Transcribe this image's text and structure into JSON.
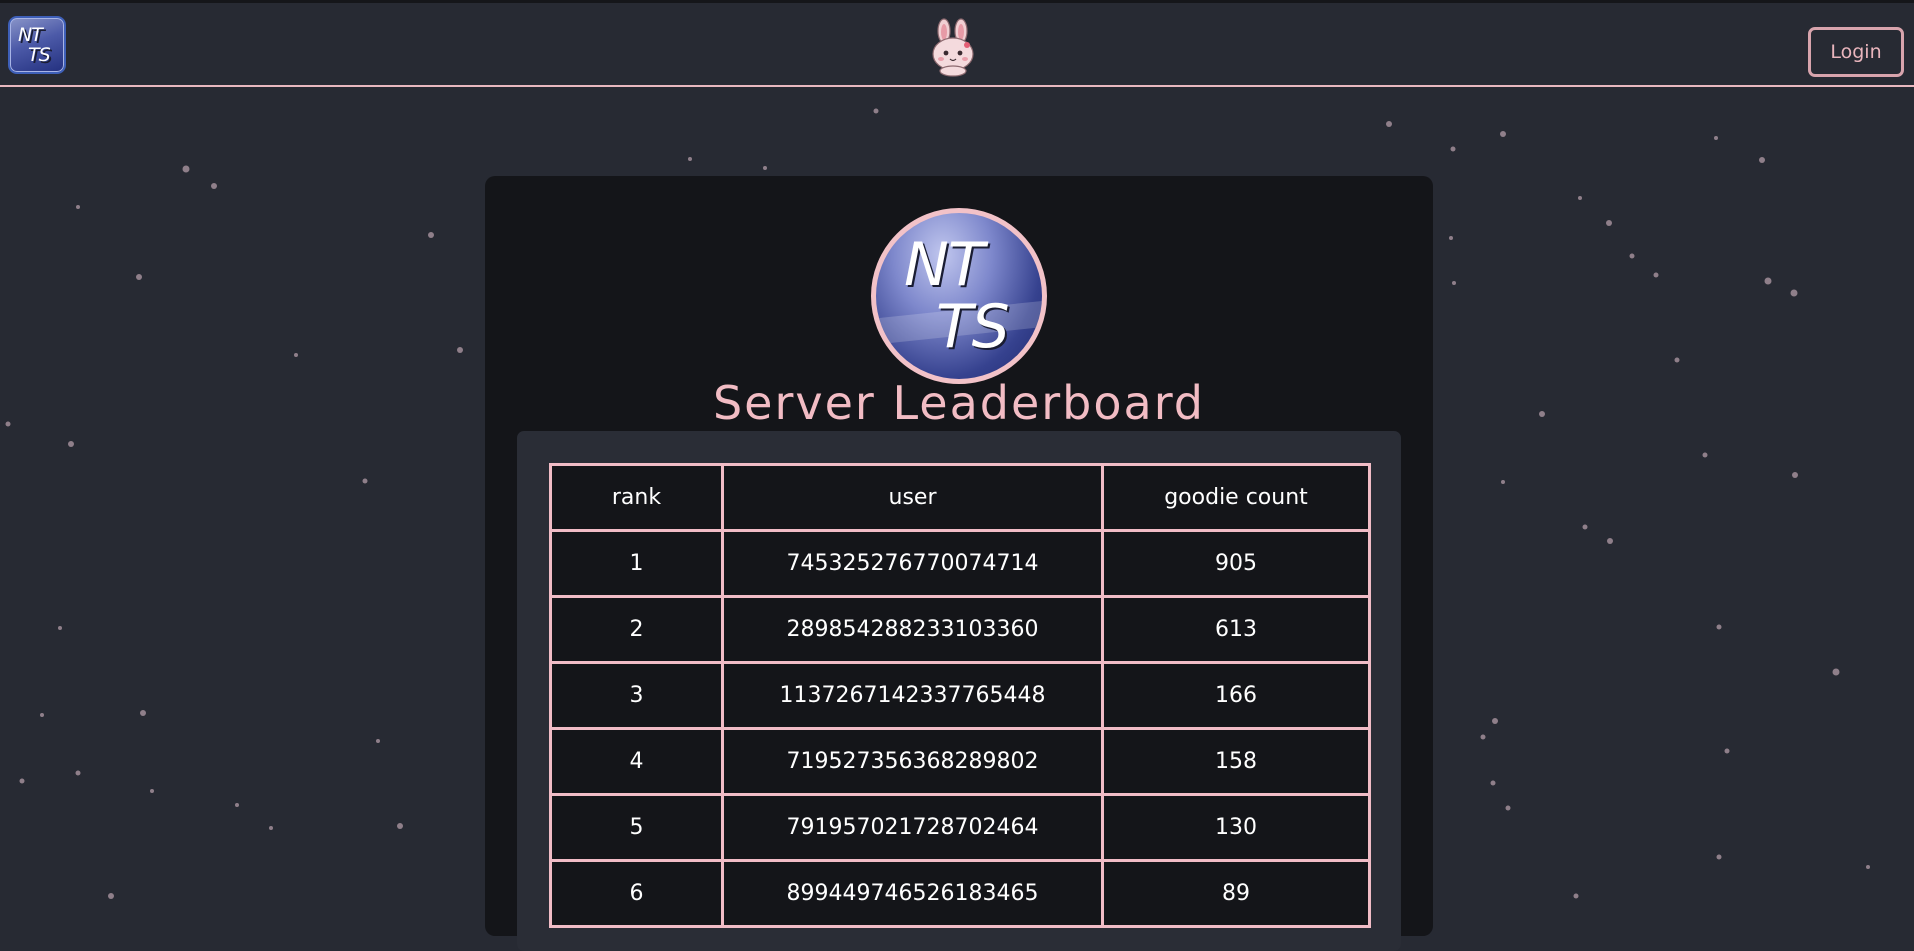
{
  "navbar": {
    "logo_text_line1": "NT",
    "logo_text_line2": "TS",
    "mascot_icon": "bunny-icon",
    "login_label": "Login",
    "accent_color": "#e8b8bf"
  },
  "hero": {
    "logo_text_line1": "NT",
    "logo_text_line2": "TS",
    "title": "Server Leaderboard"
  },
  "leaderboard": {
    "columns": [
      "rank",
      "user",
      "goodie count"
    ],
    "rows": [
      {
        "rank": "1",
        "user": "745325276770074714",
        "count": "905"
      },
      {
        "rank": "2",
        "user": "289854288233103360",
        "count": "613"
      },
      {
        "rank": "3",
        "user": "1137267142337765448",
        "count": "166"
      },
      {
        "rank": "4",
        "user": "719527356368289802",
        "count": "158"
      },
      {
        "rank": "5",
        "user": "791957021728702464",
        "count": "130"
      },
      {
        "rank": "6",
        "user": "899449746526183465",
        "count": "89"
      }
    ]
  },
  "colors": {
    "background": "#272a33",
    "card": "#141519",
    "table_border": "#f1bcc6",
    "title": "#f2bcc4"
  }
}
